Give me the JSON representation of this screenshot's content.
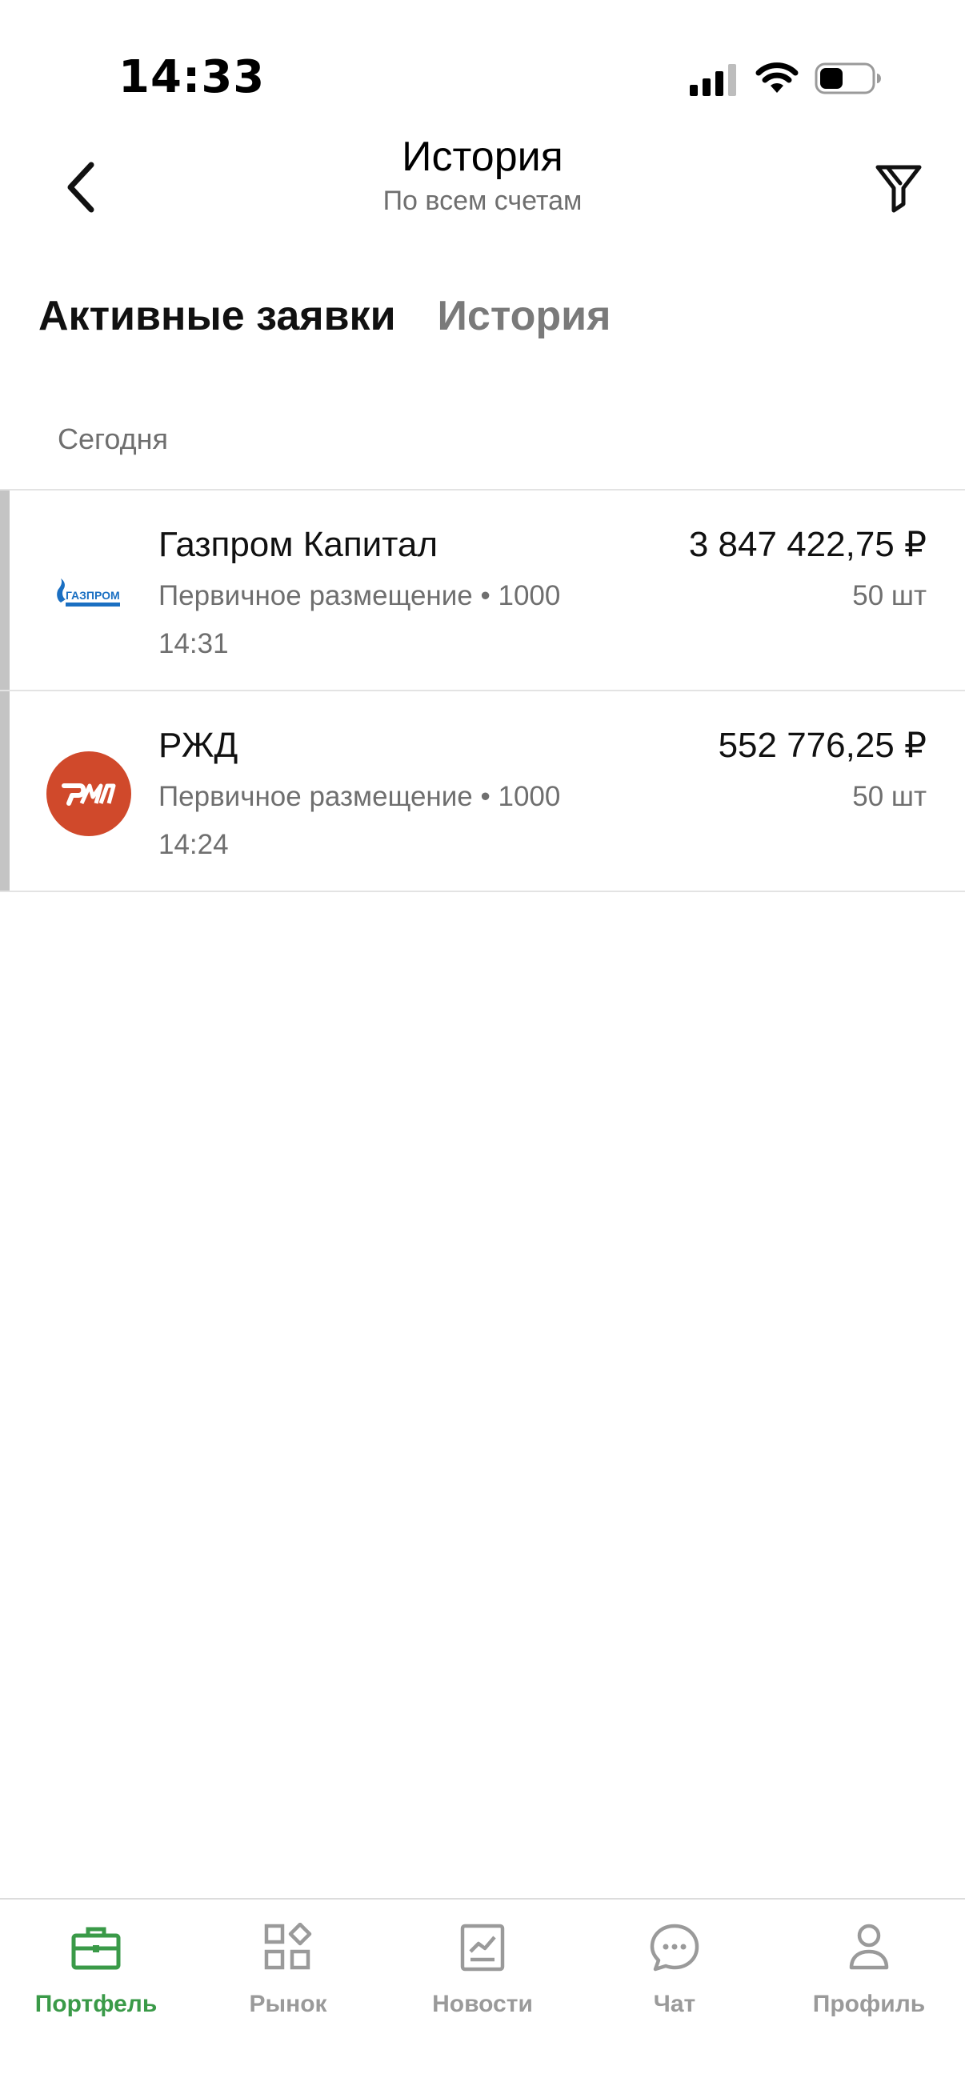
{
  "status_bar": {
    "time": "14:33",
    "icons": [
      "cellular-signal-icon",
      "wifi-icon",
      "battery-icon"
    ]
  },
  "header": {
    "back_icon": "chevron-left-icon",
    "title": "История",
    "subtitle": "По всем счетам",
    "filter_icon": "filter-icon"
  },
  "tabs": [
    {
      "label": "Активные заявки",
      "active": true
    },
    {
      "label": "История",
      "active": false
    }
  ],
  "section": {
    "label": "Сегодня"
  },
  "orders": [
    {
      "name": "Газпром Капитал",
      "description": "Первичное размещение • 1000",
      "time": "14:31",
      "amount": "3 847 422,75 ₽",
      "quantity": "50 шт",
      "logo_icon": "gazprom-logo",
      "logo_text": "ГАЗПРОМ"
    },
    {
      "name": "РЖД",
      "description": "Первичное размещение • 1000",
      "time": "14:24",
      "amount": "552 776,25 ₽",
      "quantity": "50 шт",
      "logo_icon": "rzd-logo",
      "logo_text": "РЖД"
    }
  ],
  "tabbar": [
    {
      "label": "Портфель",
      "icon": "briefcase-icon",
      "active": true
    },
    {
      "label": "Рынок",
      "icon": "market-grid-icon",
      "active": false
    },
    {
      "label": "Новости",
      "icon": "news-chart-icon",
      "active": false
    },
    {
      "label": "Чат",
      "icon": "chat-bubble-icon",
      "active": false
    },
    {
      "label": "Профиль",
      "icon": "person-icon",
      "active": false
    }
  ],
  "colors": {
    "accent": "#3a9a48",
    "inactive": "#9a9a9a",
    "secondary_text": "#6f6f6f",
    "stripe": "#c4c4c4",
    "rzd_red": "#d0492b",
    "gazprom_blue": "#1a6fc2"
  }
}
